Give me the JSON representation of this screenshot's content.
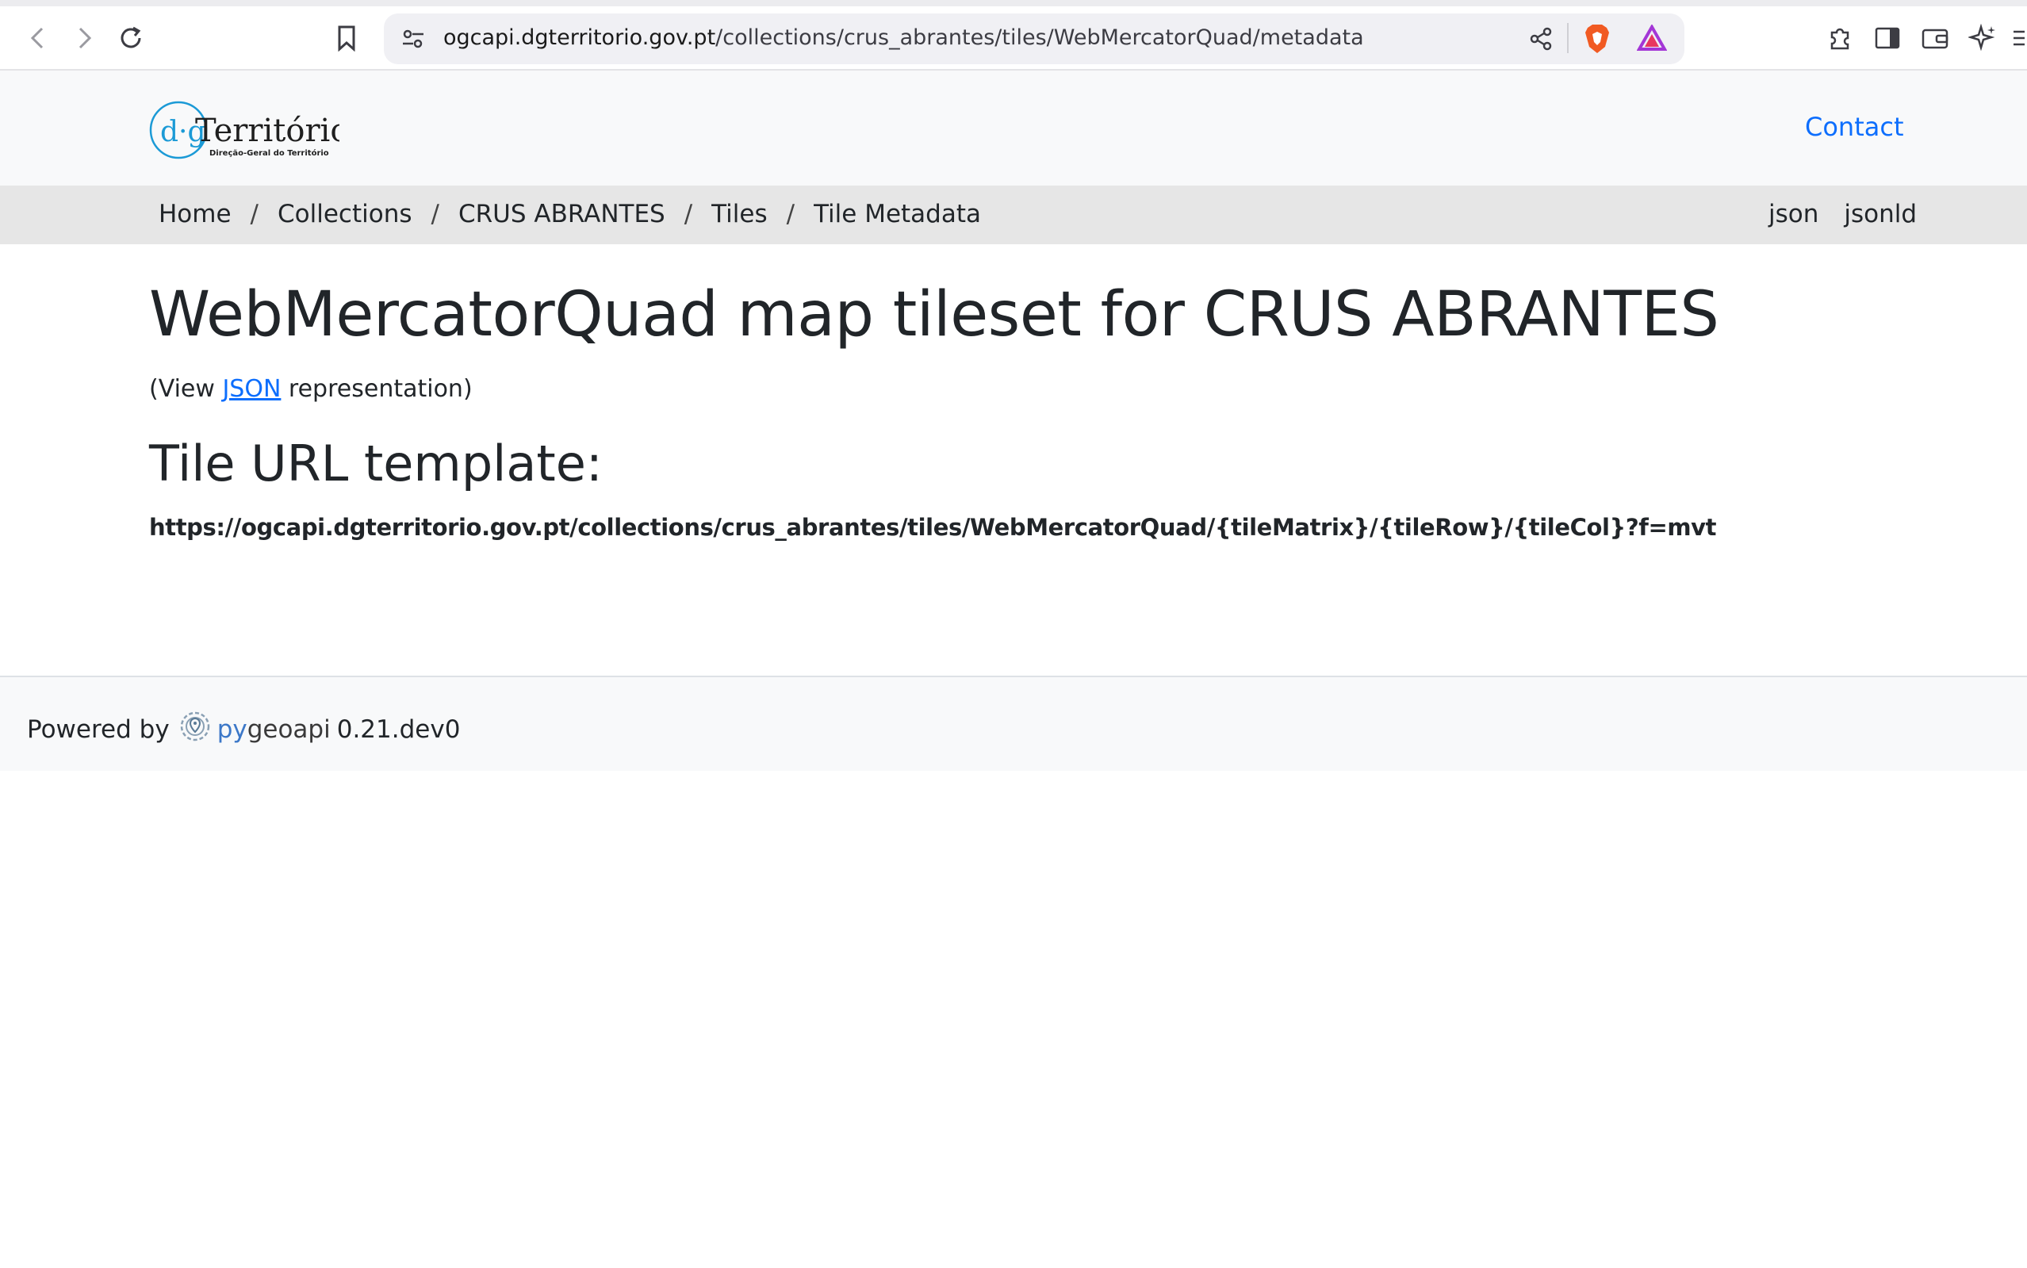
{
  "browser": {
    "url_host": "ogcapi.dgterritorio.gov.pt",
    "url_path": "/collections/crus_abrantes/tiles/WebMercatorQuad/metadata",
    "icons": [
      "back-icon",
      "forward-icon",
      "reload-icon",
      "bookmark-icon",
      "site-settings-icon",
      "share-icon",
      "brave-shields-icon",
      "brave-rewards-icon",
      "extensions-icon",
      "sidebar-icon",
      "wallet-icon",
      "leo-ai-icon",
      "menu-icon"
    ]
  },
  "header": {
    "logo_main": "Território",
    "logo_prefix": "d·g",
    "logo_sub": "Direção-Geral do Território",
    "contact_label": "Contact"
  },
  "breadcrumb": {
    "items": [
      "Home",
      "Collections",
      "CRUS ABRANTES",
      "Tiles",
      "Tile Metadata"
    ],
    "separator": "/"
  },
  "formats": [
    "json",
    "jsonld"
  ],
  "main": {
    "title": "WebMercatorQuad map tileset for CRUS ABRANTES",
    "view_prefix": "(View ",
    "view_link": "JSON",
    "view_suffix": " representation)",
    "tile_heading": "Tile URL template:",
    "tile_url": "https://ogcapi.dgterritorio.gov.pt/collections/crus_abrantes/tiles/WebMercatorQuad/{tileMatrix}/{tileRow}/{tileCol}?f=mvt"
  },
  "footer": {
    "powered_by": "Powered by",
    "brand_py": "py",
    "brand_geoapi": "geoapi",
    "version": "0.21.dev0"
  },
  "colors": {
    "link": "#0d6efd",
    "breadcrumb_bg": "#e6e6e6",
    "header_bg": "#f8f9fa",
    "logo_blue": "#1b9ad6"
  }
}
